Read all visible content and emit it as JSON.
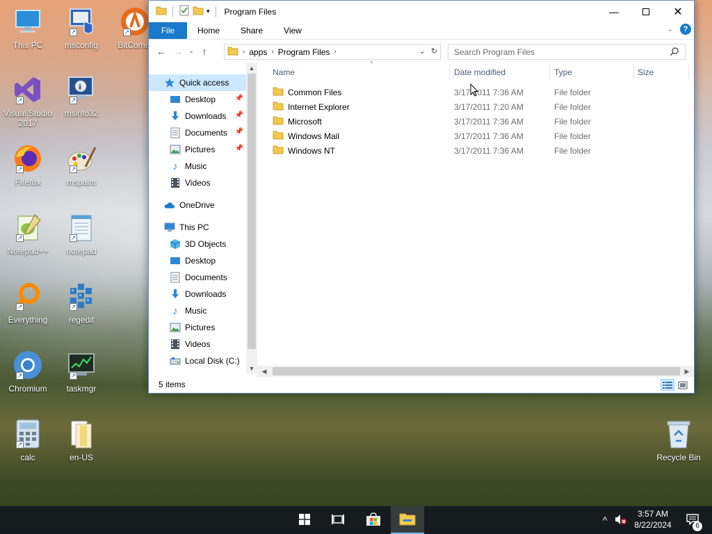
{
  "desktop": {
    "icons": [
      {
        "label": "This PC"
      },
      {
        "label": "msconfig"
      },
      {
        "label": "BitComet"
      },
      {
        "label": "Visual Studio 2017"
      },
      {
        "label": "msinfo32"
      },
      {
        "label": "Firefox"
      },
      {
        "label": "mspaint"
      },
      {
        "label": "Notepad++"
      },
      {
        "label": "notepad"
      },
      {
        "label": "Everything"
      },
      {
        "label": "regedit"
      },
      {
        "label": "Chromium"
      },
      {
        "label": "taskmgr"
      },
      {
        "label": "calc"
      },
      {
        "label": "en-US"
      },
      {
        "label": "Recycle Bin"
      }
    ]
  },
  "window": {
    "title": "Program Files",
    "ribbon_tabs": [
      "File",
      "Home",
      "Share",
      "View"
    ],
    "address": {
      "crumbs": [
        "apps",
        "Program Files"
      ]
    },
    "search": {
      "placeholder": "Search Program Files"
    },
    "nav": {
      "quick_access": "Quick access",
      "quick_items": [
        "Desktop",
        "Downloads",
        "Documents",
        "Pictures",
        "Music",
        "Videos"
      ],
      "onedrive": "OneDrive",
      "this_pc": "This PC",
      "pc_items": [
        "3D Objects",
        "Desktop",
        "Documents",
        "Downloads",
        "Music",
        "Pictures",
        "Videos",
        "Local Disk (C:)"
      ]
    },
    "columns": {
      "name": "Name",
      "date": "Date modified",
      "type": "Type",
      "size": "Size"
    },
    "files": [
      {
        "name": "Common Files",
        "date": "3/17/2011 7:36 AM",
        "type": "File folder"
      },
      {
        "name": "Internet Explorer",
        "date": "3/17/2011 7:20 AM",
        "type": "File folder"
      },
      {
        "name": "Microsoft",
        "date": "3/17/2011 7:36 AM",
        "type": "File folder"
      },
      {
        "name": "Windows Mail",
        "date": "3/17/2011 7:36 AM",
        "type": "File folder"
      },
      {
        "name": "Windows NT",
        "date": "3/17/2011 7:36 AM",
        "type": "File folder"
      }
    ],
    "status": "5 items"
  },
  "taskbar": {
    "time": "3:57 AM",
    "date": "8/22/2024",
    "notification_count": "6"
  },
  "colors": {
    "accent": "#1979ca",
    "selection": "#cce8ff",
    "folder": "#f4c84a"
  }
}
